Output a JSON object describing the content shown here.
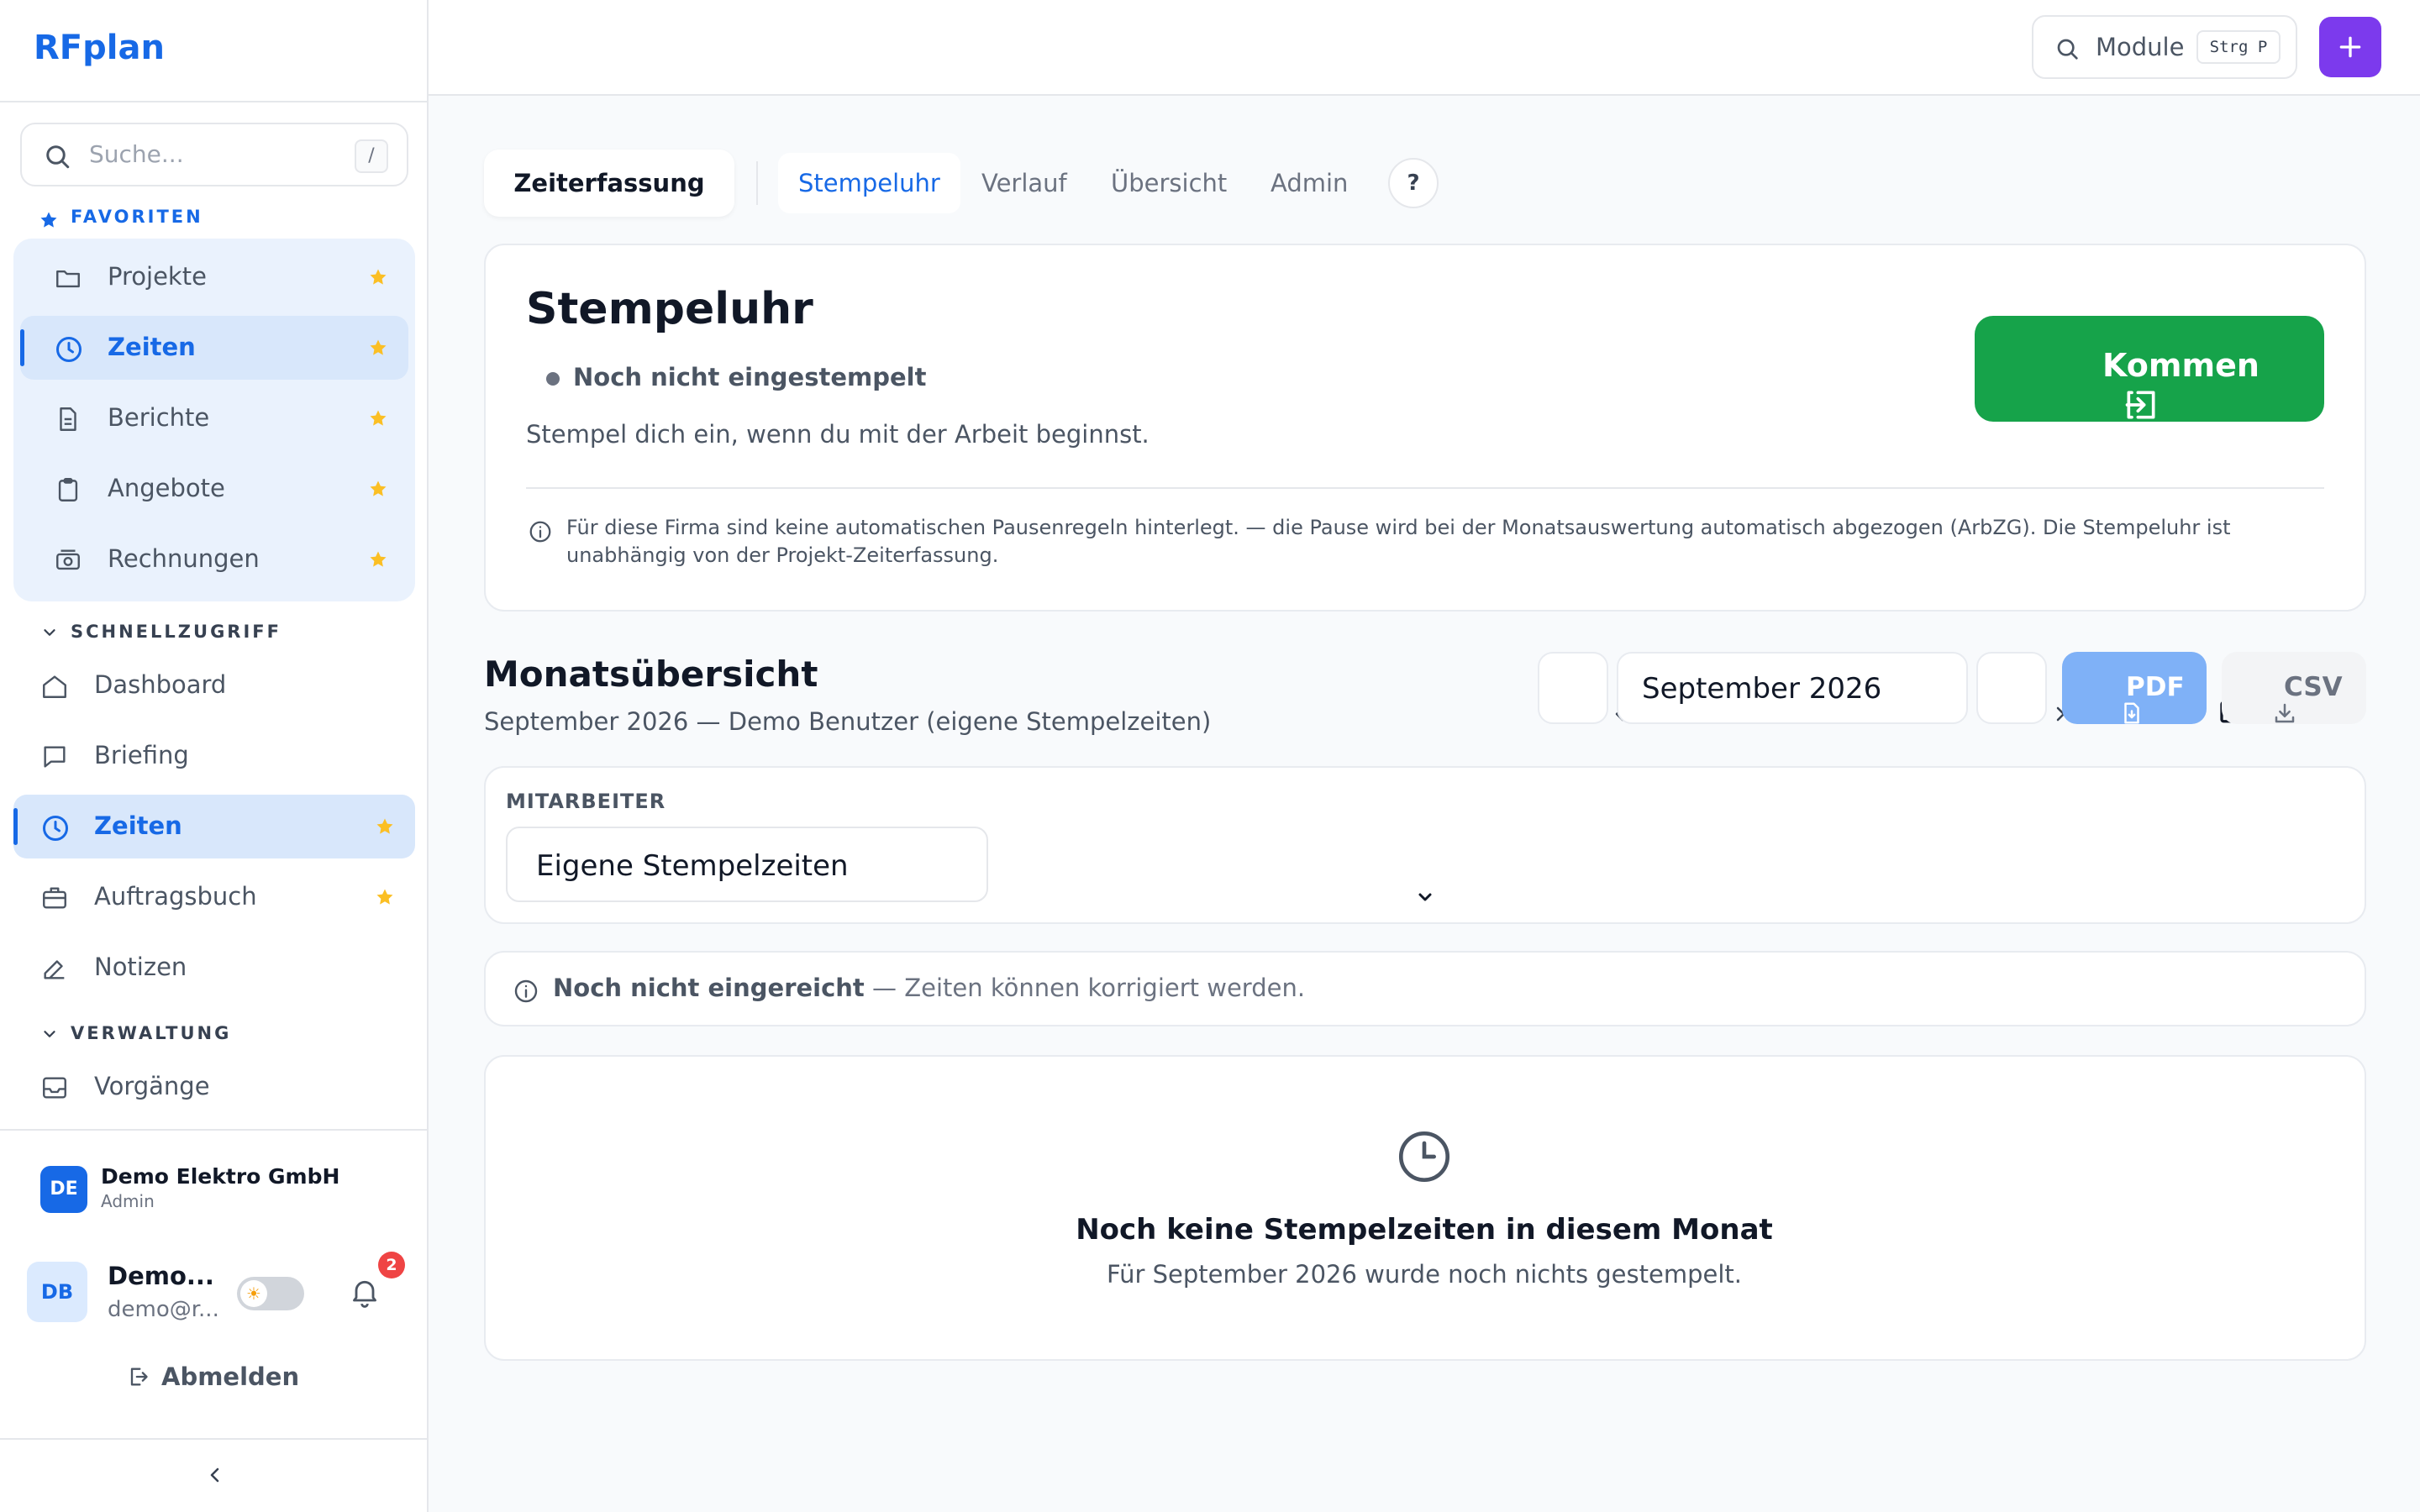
{
  "app": {
    "brand": "RFplan"
  },
  "search": {
    "placeholder": "Suche...",
    "shortcut": "/"
  },
  "sidebar": {
    "favorites_label": "FAVORITEN",
    "favorites": [
      {
        "label": "Projekte",
        "icon": "folder-icon",
        "active": false
      },
      {
        "label": "Zeiten",
        "icon": "clock-icon",
        "active": true
      },
      {
        "label": "Berichte",
        "icon": "file-icon",
        "active": false
      },
      {
        "label": "Angebote",
        "icon": "clipboard-icon",
        "active": false
      },
      {
        "label": "Rechnungen",
        "icon": "cash-icon",
        "active": false
      }
    ],
    "quick_label": "SCHNELLZUGRIFF",
    "quick": [
      {
        "label": "Dashboard",
        "icon": "home-icon"
      },
      {
        "label": "Briefing",
        "icon": "chat-icon"
      },
      {
        "label": "Zeiten",
        "icon": "clock-icon"
      },
      {
        "label": "Auftragsbuch",
        "icon": "briefcase-icon"
      },
      {
        "label": "Notizen",
        "icon": "edit-icon"
      }
    ],
    "admin_label": "VERWALTUNG",
    "admin": [
      {
        "label": "Vorgänge",
        "icon": "inbox-icon"
      }
    ],
    "accent_color": "#1769e6",
    "star_color": "#fbbf24"
  },
  "company": {
    "initials": "DE",
    "name": "Demo Elektro GmbH",
    "role": "Admin"
  },
  "user": {
    "initials": "DB",
    "name": "Demo...",
    "email": "demo@r...",
    "notifications": "2"
  },
  "logout_label": "Abmelden",
  "topbar": {
    "module_label": "Module",
    "module_shortcut": "Strg P",
    "plus_color": "#7c3aed"
  },
  "tabs": {
    "module": "Zeiterfassung",
    "items": [
      "Stempeluhr",
      "Verlauf",
      "Übersicht",
      "Admin"
    ],
    "active": "Stempeluhr",
    "help": "?"
  },
  "stempeluhr": {
    "title": "Stempeluhr",
    "status": "Noch nicht eingestempelt",
    "hint": "Stempel dich ein, wenn du mit der Arbeit beginnst.",
    "button": "Kommen",
    "button_color": "#16a34a",
    "info": "Für diese Firma sind keine automatischen Pausenregeln hinterlegt. — die Pause wird bei der Monatsauswertung automatisch abgezogen (ArbZG). Die Stempeluhr ist unabhängig von der Projekt-Zeiterfassung."
  },
  "monthly": {
    "title": "Monatsübersicht",
    "subtitle": "September 2026 — Demo Benutzer (eigene Stempelzeiten)",
    "month": "September  2026",
    "pdf": "PDF",
    "csv": "CSV",
    "employee_label": "MITARBEITER",
    "employee_value": "Eigene Stempelzeiten",
    "submission_status": "Noch nicht eingereicht",
    "submission_note": " — Zeiten können korrigiert werden.",
    "empty_title": "Noch keine Stempelzeiten in diesem Monat",
    "empty_sub": "Für September 2026 wurde noch nichts gestempelt."
  }
}
